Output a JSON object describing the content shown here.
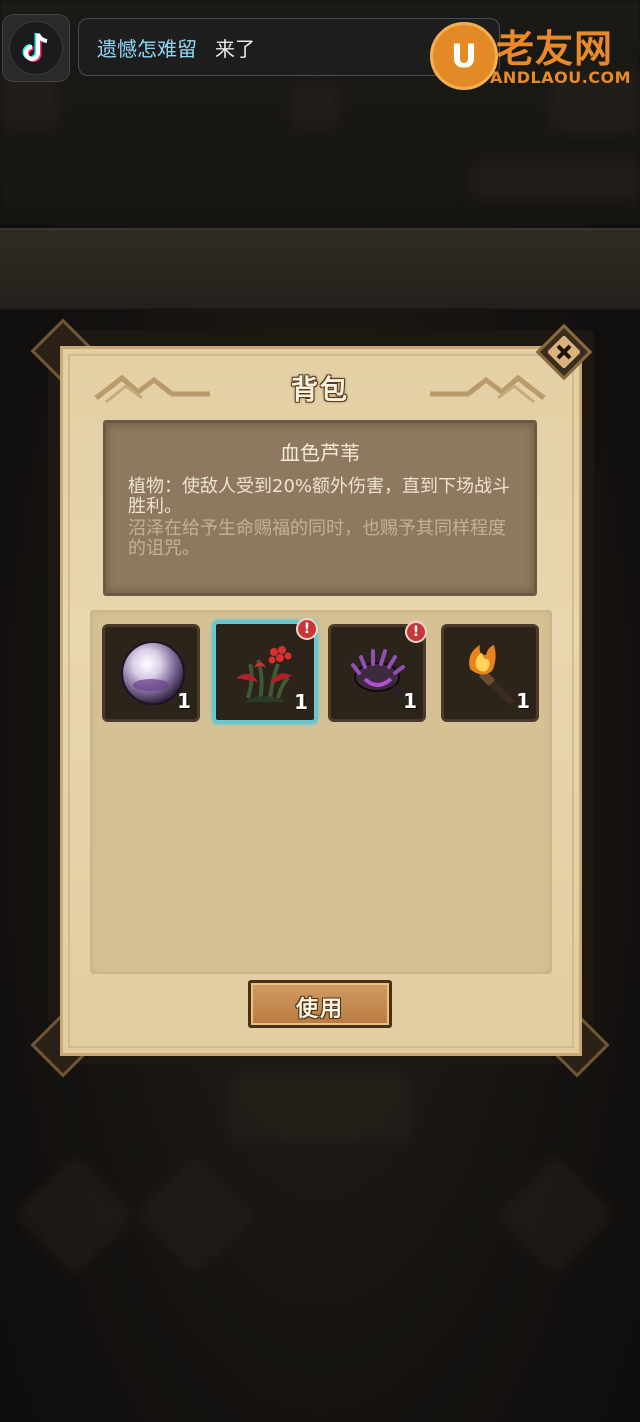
{
  "notification": {
    "app_icon": "tiktok-icon",
    "user_name": "遗憾怎难留",
    "message": "来了"
  },
  "watermark": {
    "brand_icon": "u-logo-icon",
    "title": "老友网",
    "subtitle": "ANDLAOU.COM"
  },
  "modal": {
    "title": "背包",
    "close_icon": "close-x-icon",
    "selected_item": {
      "name": "血色芦苇",
      "effect": "植物：使敌人受到20%额外伤害，直到下场战斗胜利。",
      "flavor": "沼泽在给予生命赐福的同时，也赐予其同样程度的诅咒。"
    },
    "items": [
      {
        "icon": "purple-orb-icon",
        "count": "1",
        "selected": false,
        "new": false
      },
      {
        "icon": "red-reed-plant-icon",
        "count": "1",
        "selected": true,
        "new": true,
        "badge": "!"
      },
      {
        "icon": "spiked-purple-claw-icon",
        "count": "1",
        "selected": false,
        "new": true,
        "badge": "!"
      },
      {
        "icon": "torch-icon",
        "count": "1",
        "selected": false,
        "new": false
      }
    ],
    "use_button": "使用"
  },
  "colors": {
    "selected_border": "#68c7d0",
    "alert_red": "#c9363a",
    "notif_name": "#8fd6f4",
    "watermark_orange": "#e8892a"
  }
}
